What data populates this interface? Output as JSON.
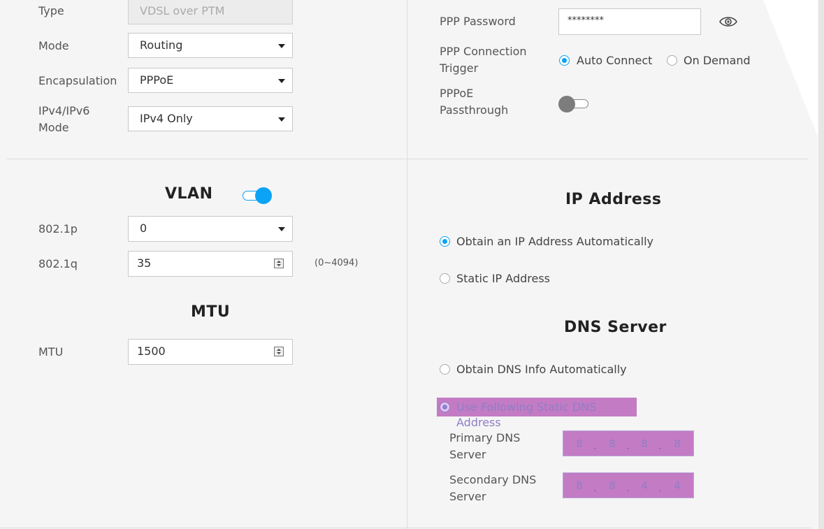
{
  "wan": {
    "type": {
      "label": "Type",
      "value": "VDSL over PTM"
    },
    "mode": {
      "label": "Mode",
      "value": "Routing"
    },
    "encapsulation": {
      "label": "Encapsulation",
      "value": "PPPoE"
    },
    "ip_mode": {
      "label_line1": "IPv4/IPv6",
      "label_line2": "Mode",
      "value": "IPv4 Only"
    }
  },
  "ppp": {
    "password": {
      "label": "PPP Password",
      "value": "********"
    },
    "trigger": {
      "label_line1": "PPP Connection",
      "label_line2": "Trigger",
      "options": [
        "Auto Connect",
        "On Demand"
      ],
      "selected": "Auto Connect"
    },
    "passthrough": {
      "label_line1": "PPPoE",
      "label_line2": "Passthrough",
      "enabled": false
    }
  },
  "vlan": {
    "title": "VLAN",
    "enabled": true,
    "p": {
      "label": "802.1p",
      "value": "0"
    },
    "q": {
      "label": "802.1q",
      "value": "35",
      "range": "(0~4094)"
    }
  },
  "mtu": {
    "title": "MTU",
    "label": "MTU",
    "value": "1500"
  },
  "ip_address": {
    "title": "IP Address",
    "options": [
      "Obtain an IP Address Automatically",
      "Static IP Address"
    ],
    "selected": "Obtain an IP Address Automatically"
  },
  "dns": {
    "title": "DNS Server",
    "options": [
      "Obtain DNS Info Automatically",
      "Use Following Static DNS Address"
    ],
    "selected": "Use Following Static DNS Address",
    "primary": {
      "label_line1": "Primary DNS",
      "label_line2": "Server",
      "octets": [
        "8",
        "8",
        "8",
        "8"
      ]
    },
    "secondary": {
      "label_line1": "Secondary DNS",
      "label_line2": "Server",
      "octets": [
        "8",
        "8",
        "4",
        "4"
      ]
    },
    "dot": "."
  },
  "colors": {
    "accent": "#0aa3f5",
    "highlight": "#c37bc4"
  },
  "icons": {
    "password_toggle": "eye-icon"
  }
}
